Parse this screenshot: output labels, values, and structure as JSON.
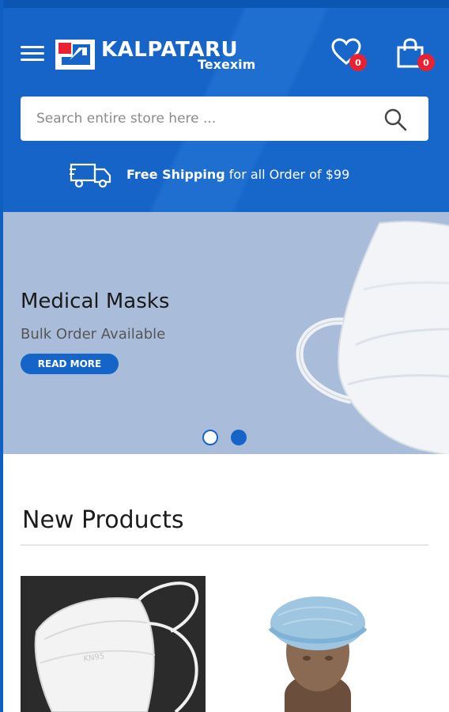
{
  "header": {
    "logo": {
      "name": "KALPATARU",
      "subname": "Texexim"
    },
    "wishlist": {
      "icon": "heart-icon",
      "count": "0"
    },
    "cart": {
      "icon": "shopping-bag-icon",
      "count": "0"
    },
    "menu_icon": "hamburger-menu-icon"
  },
  "search": {
    "placeholder": "Search entire store here ...",
    "value": "",
    "icon": "search-icon"
  },
  "shipping": {
    "icon": "truck-icon",
    "bold": "Free Shipping",
    "rest": " for all Order of $99"
  },
  "hero": {
    "title": "Medical Masks",
    "subtitle": "Bulk Order Available",
    "button_label": "READ MORE",
    "slides": 2,
    "active_slide": 2
  },
  "new_products": {
    "title": "New Products",
    "items": [
      {
        "image": "face-mask-product-image"
      },
      {
        "image": "hair-net-cap-product-image"
      }
    ]
  },
  "colors": {
    "brand_blue": "#1764c8",
    "badge_red": "#e92231",
    "hero_bg": "#a9bddb"
  }
}
